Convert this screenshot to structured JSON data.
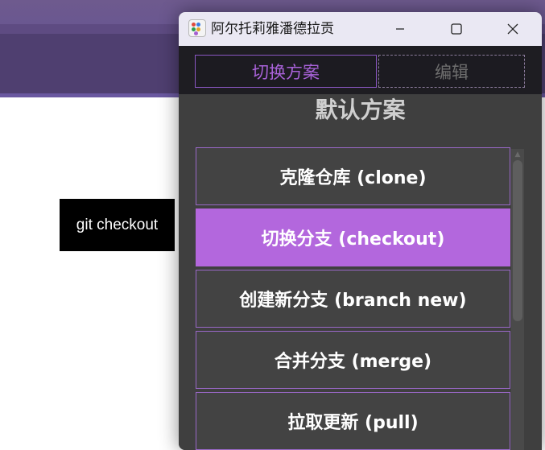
{
  "tooltip": {
    "text": "git checkout"
  },
  "window": {
    "title": "阿尔托莉雅潘德拉贡",
    "icons": {
      "app": "app-icon",
      "minimize": "minimize-icon",
      "maximize": "maximize-icon",
      "close": "close-icon"
    }
  },
  "tabs": [
    {
      "label": "切换方案",
      "active": true
    },
    {
      "label": "编辑",
      "active": false
    }
  ],
  "scheme": {
    "title": "默认方案",
    "items": [
      {
        "label": "克隆仓库 (clone)",
        "selected": false
      },
      {
        "label": "切换分支 (checkout)",
        "selected": true
      },
      {
        "label": "创建新分支 (branch new)",
        "selected": false
      },
      {
        "label": "合并分支 (merge)",
        "selected": false
      },
      {
        "label": "拉取更新 (pull)",
        "selected": false
      }
    ]
  },
  "colors": {
    "accent": "#b367dd",
    "panel": "#3f3f3f",
    "tab_bar": "#1e1d22",
    "border": "#9a68c8"
  }
}
